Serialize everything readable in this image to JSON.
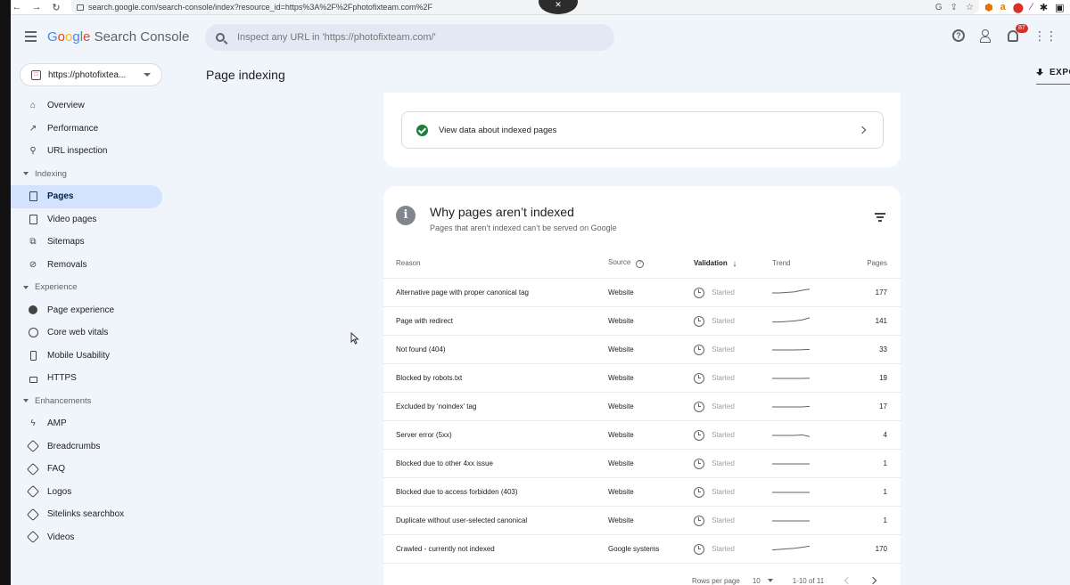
{
  "browser": {
    "url": "search.google.com/search-console/index?resource_id=https%3A%2F%2Fphotofixteam.com%2F"
  },
  "app": {
    "logo_google": [
      "G",
      "o",
      "o",
      "g",
      "l",
      "e"
    ],
    "logo_product": "Search Console",
    "search_placeholder": "Inspect any URL in 'https://photofixteam.com/'",
    "notification_count": "87"
  },
  "property": {
    "label": "https://photofixtea..."
  },
  "page": {
    "title": "Page indexing",
    "export_label": "EXPO"
  },
  "sidebar": {
    "items": [
      {
        "label": "Overview",
        "icon": "home-icon"
      },
      {
        "label": "Performance",
        "icon": "trending-up-icon"
      },
      {
        "label": "URL inspection",
        "icon": "search-icon"
      }
    ],
    "sections": [
      {
        "label": "Indexing",
        "items": [
          {
            "label": "Pages",
            "icon": "pages-icon",
            "active": true
          },
          {
            "label": "Video pages",
            "icon": "video-pages-icon"
          },
          {
            "label": "Sitemaps",
            "icon": "sitemap-icon"
          },
          {
            "label": "Removals",
            "icon": "removals-icon"
          }
        ]
      },
      {
        "label": "Experience",
        "items": [
          {
            "label": "Page experience",
            "icon": "page-experience-icon"
          },
          {
            "label": "Core web vitals",
            "icon": "gauge-icon"
          },
          {
            "label": "Mobile Usability",
            "icon": "mobile-icon"
          },
          {
            "label": "HTTPS",
            "icon": "lock-icon"
          }
        ]
      },
      {
        "label": "Enhancements",
        "items": [
          {
            "label": "AMP",
            "icon": "bolt-icon"
          },
          {
            "label": "Breadcrumbs",
            "icon": "layers-icon"
          },
          {
            "label": "FAQ",
            "icon": "layers-icon"
          },
          {
            "label": "Logos",
            "icon": "layers-icon"
          },
          {
            "label": "Sitelinks searchbox",
            "icon": "layers-icon"
          },
          {
            "label": "Videos",
            "icon": "layers-icon"
          }
        ]
      }
    ]
  },
  "indexed_link": {
    "label": "View data about indexed pages"
  },
  "why_card": {
    "title": "Why pages aren’t indexed",
    "subtitle": "Pages that aren’t indexed can’t be served on Google",
    "columns": {
      "reason": "Reason",
      "source": "Source",
      "validation": "Validation",
      "trend": "Trend",
      "pages": "Pages"
    },
    "rows": [
      {
        "reason": "Alternative page with proper canonical tag",
        "source": "Website",
        "validation": "Started",
        "pages": "177",
        "trend": [
          0.5,
          0.5,
          0.45,
          0.4,
          0.25,
          0.15
        ]
      },
      {
        "reason": "Page with redirect",
        "source": "Website",
        "validation": "Started",
        "pages": "141",
        "trend": [
          0.55,
          0.55,
          0.5,
          0.45,
          0.35,
          0.15
        ]
      },
      {
        "reason": "Not found (404)",
        "source": "Website",
        "validation": "Started",
        "pages": "33",
        "trend": [
          0.5,
          0.5,
          0.5,
          0.5,
          0.48,
          0.45
        ]
      },
      {
        "reason": "Blocked by robots.txt",
        "source": "Website",
        "validation": "Started",
        "pages": "19",
        "trend": [
          0.5,
          0.5,
          0.5,
          0.5,
          0.5,
          0.48
        ]
      },
      {
        "reason": "Excluded by ‘noindex’ tag",
        "source": "Website",
        "validation": "Started",
        "pages": "17",
        "trend": [
          0.5,
          0.5,
          0.5,
          0.5,
          0.5,
          0.45
        ]
      },
      {
        "reason": "Server error (5xx)",
        "source": "Website",
        "validation": "Started",
        "pages": "4",
        "trend": [
          0.5,
          0.5,
          0.5,
          0.5,
          0.45,
          0.6
        ]
      },
      {
        "reason": "Blocked due to other 4xx issue",
        "source": "Website",
        "validation": "Started",
        "pages": "1",
        "trend": [
          0.5,
          0.5,
          0.5,
          0.5,
          0.5,
          0.5
        ]
      },
      {
        "reason": "Blocked due to access forbidden (403)",
        "source": "Website",
        "validation": "Started",
        "pages": "1",
        "trend": [
          0.5,
          0.5,
          0.5,
          0.5,
          0.5,
          0.5
        ]
      },
      {
        "reason": "Duplicate without user-selected canonical",
        "source": "Website",
        "validation": "Started",
        "pages": "1",
        "trend": [
          0.5,
          0.5,
          0.5,
          0.5,
          0.5,
          0.5
        ]
      },
      {
        "reason": "Crawled - currently not indexed",
        "source": "Google systems",
        "validation": "Started",
        "pages": "170",
        "trend": [
          0.55,
          0.5,
          0.45,
          0.4,
          0.3,
          0.2
        ]
      }
    ],
    "pagination": {
      "rows_per_page_label": "Rows per page",
      "rows_per_page": "10",
      "range": "1-10 of 11"
    }
  },
  "colors": {
    "active_nav": "#d3e3fd",
    "success": "#188038",
    "accent": "#1a73e8"
  }
}
